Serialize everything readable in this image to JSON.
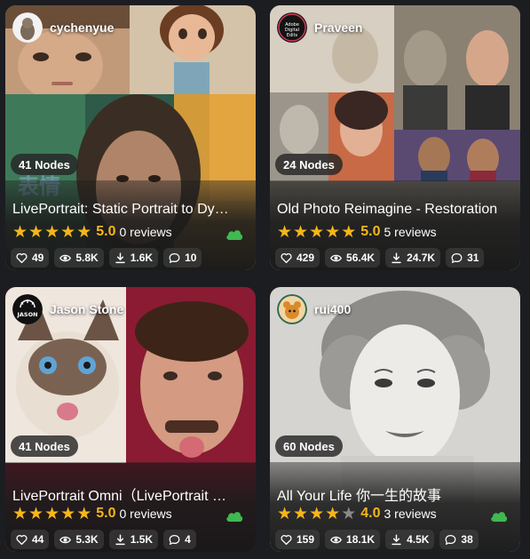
{
  "cards": [
    {
      "author": "cychenyue",
      "nodes_label": "41 Nodes",
      "title": "LivePortrait: Static Portrait to Dy…",
      "rating": 5,
      "score": "5.0",
      "reviews": "0 reviews",
      "stats": {
        "likes": "49",
        "views": "5.8K",
        "downloads": "1.6K",
        "comments": "10"
      },
      "artwork_caption": "表情"
    },
    {
      "author": "Praveen",
      "avatar_text": "Adobe Digital Edits",
      "nodes_label": "24 Nodes",
      "title": "Old Photo Reimagine - Restoration",
      "rating": 5,
      "score": "5.0",
      "reviews": "5 reviews",
      "stats": {
        "likes": "429",
        "views": "56.4K",
        "downloads": "24.7K",
        "comments": "31"
      }
    },
    {
      "author": "Jason Stone",
      "avatar_text": "JASON",
      "nodes_label": "41 Nodes",
      "title": "LivePortrait Omni（LivePortrait …",
      "rating": 5,
      "score": "5.0",
      "reviews": "0 reviews",
      "stats": {
        "likes": "44",
        "views": "5.3K",
        "downloads": "1.5K",
        "comments": "4"
      }
    },
    {
      "author": "rui400",
      "nodes_label": "60 Nodes",
      "title": "All Your Life 你一生的故事",
      "rating": 4,
      "score": "4.0",
      "reviews": "3 reviews",
      "stats": {
        "likes": "159",
        "views": "18.1K",
        "downloads": "4.5K",
        "comments": "38"
      }
    }
  ],
  "colors": {
    "star": "#f5b61a",
    "cloud": "#3fb950",
    "background": "#1c1d21"
  },
  "icons": {
    "likes": "heart-icon",
    "views": "eye-icon",
    "downloads": "download-icon",
    "comments": "comment-icon",
    "cloud": "cloud-icon"
  }
}
